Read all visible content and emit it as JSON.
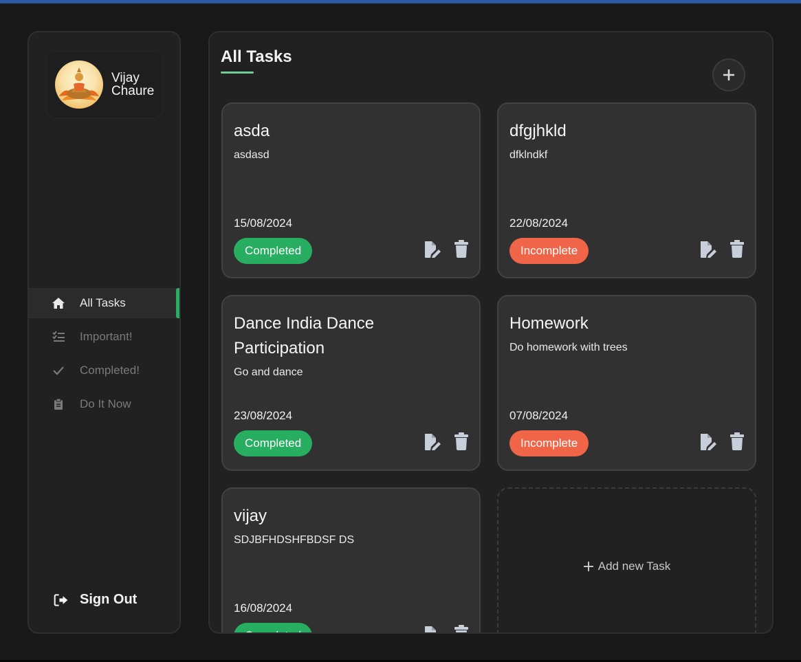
{
  "user": {
    "name": "Vijay Chaure"
  },
  "nav": {
    "items": [
      {
        "label": "All Tasks",
        "icon": "home-icon"
      },
      {
        "label": "Important!",
        "icon": "list-check-icon"
      },
      {
        "label": "Completed!",
        "icon": "check-icon"
      },
      {
        "label": "Do It Now",
        "icon": "clipboard-icon"
      }
    ],
    "sign_out": "Sign Out"
  },
  "main": {
    "title": "All Tasks",
    "add_new_label": "Add new Task"
  },
  "tasks": [
    {
      "title": "asda",
      "description": "asdasd",
      "date": "15/08/2024",
      "status": "Completed"
    },
    {
      "title": "dfgjhkld",
      "description": "dfklndkf",
      "date": "22/08/2024",
      "status": "Incomplete"
    },
    {
      "title": "Dance India Dance Participation",
      "description": "Go and dance",
      "date": "23/08/2024",
      "status": "Completed"
    },
    {
      "title": "Homework",
      "description": "Do homework with trees",
      "date": "07/08/2024",
      "status": "Incomplete"
    },
    {
      "title": "vijay",
      "description": "SDJBFHDSHFBDSF DS",
      "date": "16/08/2024",
      "status": "Completed"
    }
  ],
  "colors": {
    "accent": "#27ae60",
    "completed": "#27ae60",
    "incomplete": "#f06548",
    "underline": "#6fcf97"
  }
}
